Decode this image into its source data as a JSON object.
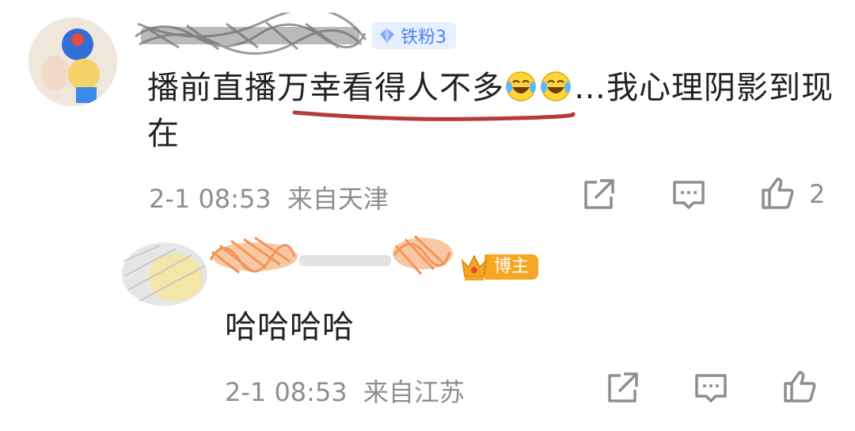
{
  "comment": {
    "badge": "铁粉3",
    "text_before": "播前直播",
    "text_underlined": "万幸看得人不多",
    "text_after": "…我心理阴影到现在",
    "emojis": [
      "laugh-cry-emoji",
      "laugh-cry-emoji"
    ],
    "time": "2-1 08:53",
    "location": "来自天津",
    "like_count": "2"
  },
  "reply": {
    "badge": "博主",
    "text": "哈哈哈哈",
    "time": "2-1 08:53",
    "location": "来自江苏"
  },
  "colors": {
    "underline": "#c0392b",
    "fan_badge_bg": "#e6f0ff",
    "fan_badge_text": "#4c84f0",
    "host_badge": "#f5a623",
    "meta_text": "#8e8e8e"
  }
}
